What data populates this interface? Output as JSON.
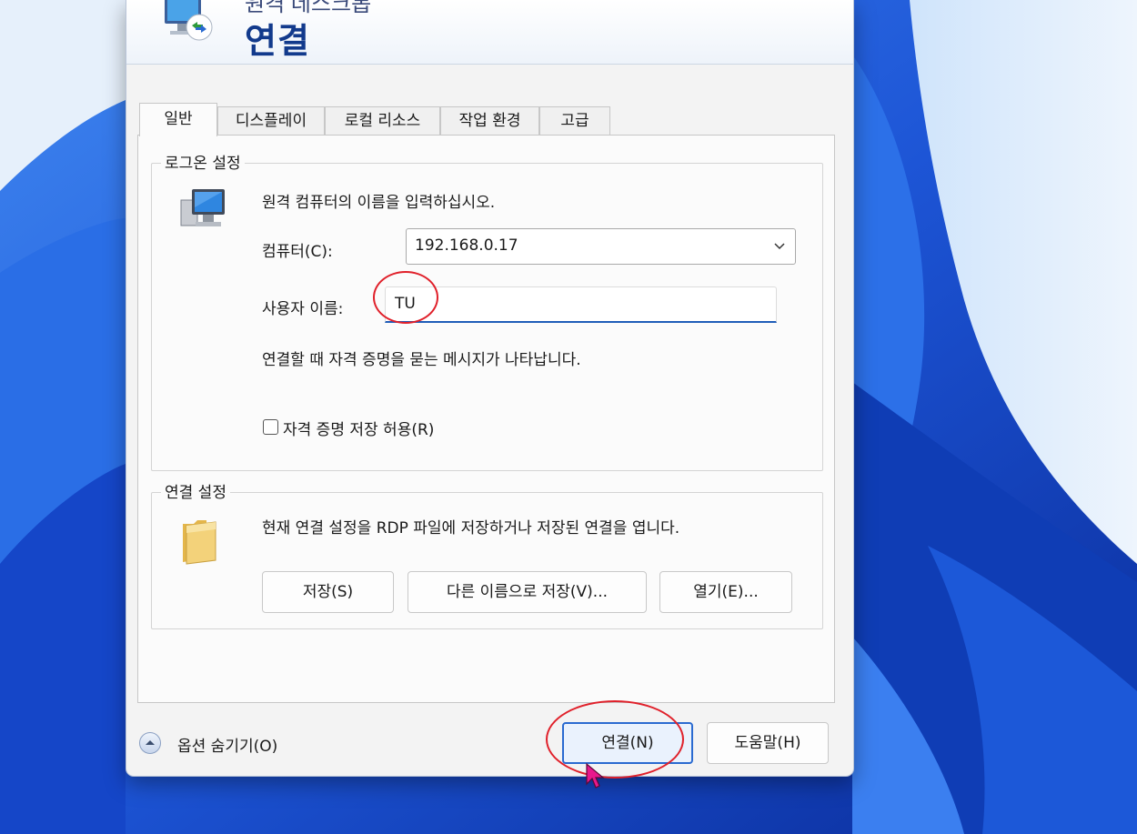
{
  "banner": {
    "subtitle": "원격 데스크톱",
    "title": "연결"
  },
  "tabs": [
    {
      "label": "일반"
    },
    {
      "label": "디스플레이"
    },
    {
      "label": "로컬 리소스"
    },
    {
      "label": "작업 환경"
    },
    {
      "label": "고급"
    }
  ],
  "logon": {
    "legend": "로그온 설정",
    "instruction": "원격 컴퓨터의 이름을 입력하십시오.",
    "computer_label": "컴퓨터(C):",
    "computer_value": "192.168.0.17",
    "username_label": "사용자 이름:",
    "username_value": "TU",
    "prompt_note": "연결할 때 자격 증명을 묻는 메시지가 나타납니다.",
    "save_credentials_label": "자격 증명 저장 허용(R)",
    "save_credentials_checked": false
  },
  "connection_settings": {
    "legend": "연결 설정",
    "description": "현재 연결 설정을 RDP 파일에 저장하거나 저장된 연결을 엽니다.",
    "save_label": "저장(S)",
    "save_as_label": "다른 이름으로 저장(V)...",
    "open_label": "열기(E)..."
  },
  "footer": {
    "hide_options_label": "옵션 숨기기(O)",
    "connect_label": "연결(N)",
    "help_label": "도움말(H)"
  },
  "colors": {
    "accent": "#2a6ad0",
    "title_blue": "#123a8c",
    "annotation_red": "#e0202a"
  }
}
